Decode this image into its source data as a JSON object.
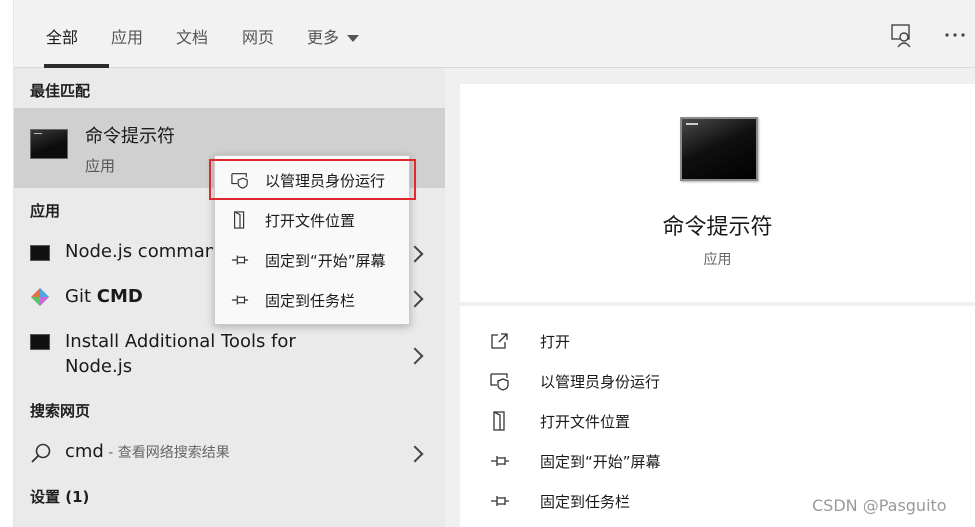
{
  "tabs": {
    "all": "全部",
    "apps": "应用",
    "documents": "文档",
    "web": "网页",
    "more": "更多"
  },
  "left": {
    "best_match_title": "最佳匹配",
    "best_match": {
      "name": "命令提示符",
      "type": "应用"
    },
    "apps_title": "应用",
    "apps": [
      {
        "name": "Node.js command prompt"
      },
      {
        "name_prefix": "Git ",
        "name_bold": "CMD"
      },
      {
        "line1": "Install Additional Tools for",
        "line2": "Node.js"
      }
    ],
    "web_title": "搜索网页",
    "web_item": {
      "query": "cmd",
      "hint": " - 查看网络搜索结果"
    },
    "settings_title": "设置 (1)"
  },
  "context_menu": [
    {
      "label": "以管理员身份运行",
      "icon": "shield-window-icon"
    },
    {
      "label": "打开文件位置",
      "icon": "file-location-icon"
    },
    {
      "label": "固定到“开始”屏幕",
      "icon": "pin-icon"
    },
    {
      "label": "固定到任务栏",
      "icon": "pin-icon"
    }
  ],
  "right": {
    "title": "命令提示符",
    "subtitle": "应用",
    "actions": [
      {
        "label": "打开",
        "icon": "open-icon"
      },
      {
        "label": "以管理员身份运行",
        "icon": "shield-window-icon"
      },
      {
        "label": "打开文件位置",
        "icon": "file-location-icon"
      },
      {
        "label": "固定到“开始”屏幕",
        "icon": "pin-icon"
      },
      {
        "label": "固定到任务栏",
        "icon": "pin-icon"
      }
    ]
  },
  "watermark": "CSDN @Pasguito",
  "colors": {
    "highlight": "#e0282e",
    "selected_row": "#d0d0d0"
  }
}
